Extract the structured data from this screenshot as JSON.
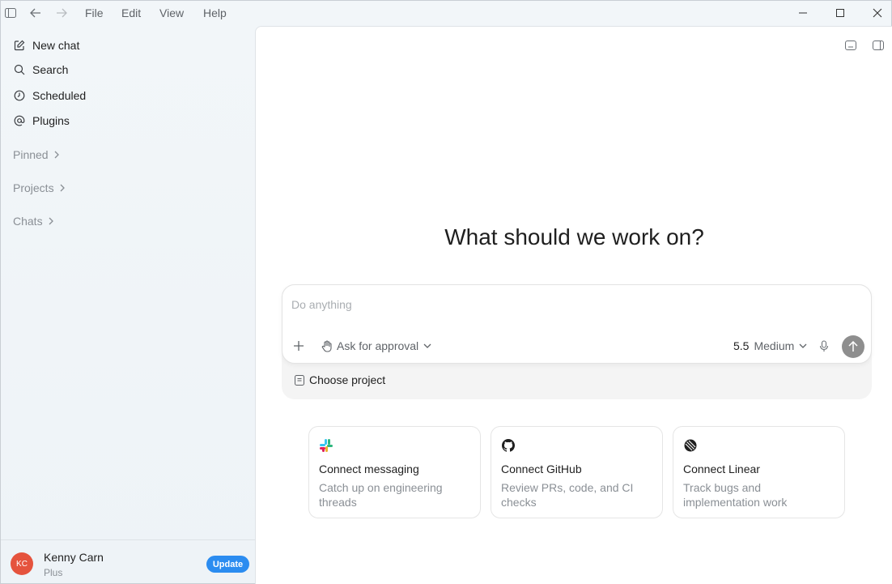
{
  "titlebar": {
    "menu": [
      "File",
      "Edit",
      "View",
      "Help"
    ]
  },
  "sidebar": {
    "items": [
      {
        "label": "New chat",
        "icon": "edit-icon"
      },
      {
        "label": "Search",
        "icon": "search-icon"
      },
      {
        "label": "Scheduled",
        "icon": "clock-icon"
      },
      {
        "label": "Plugins",
        "icon": "at-icon"
      }
    ],
    "sections": [
      "Pinned",
      "Projects",
      "Chats"
    ]
  },
  "user": {
    "initials": "KC",
    "name": "Kenny Carn",
    "plan": "Plus",
    "update_label": "Update",
    "avatar_color": "#e5533d",
    "update_color": "#2b8cf0"
  },
  "main": {
    "headline": "What should we work on?",
    "composer": {
      "placeholder": "Do anything",
      "approval_label": "Ask for approval",
      "model_version": "5.5",
      "model_effort": "Medium",
      "choose_project": "Choose project"
    },
    "cards": [
      {
        "title": "Connect messaging",
        "description": "Catch up on engineering threads",
        "icon": "slack-icon"
      },
      {
        "title": "Connect GitHub",
        "description": "Review PRs, code, and CI checks",
        "icon": "github-icon"
      },
      {
        "title": "Connect Linear",
        "description": "Track bugs and implementation work",
        "icon": "linear-icon"
      }
    ]
  }
}
